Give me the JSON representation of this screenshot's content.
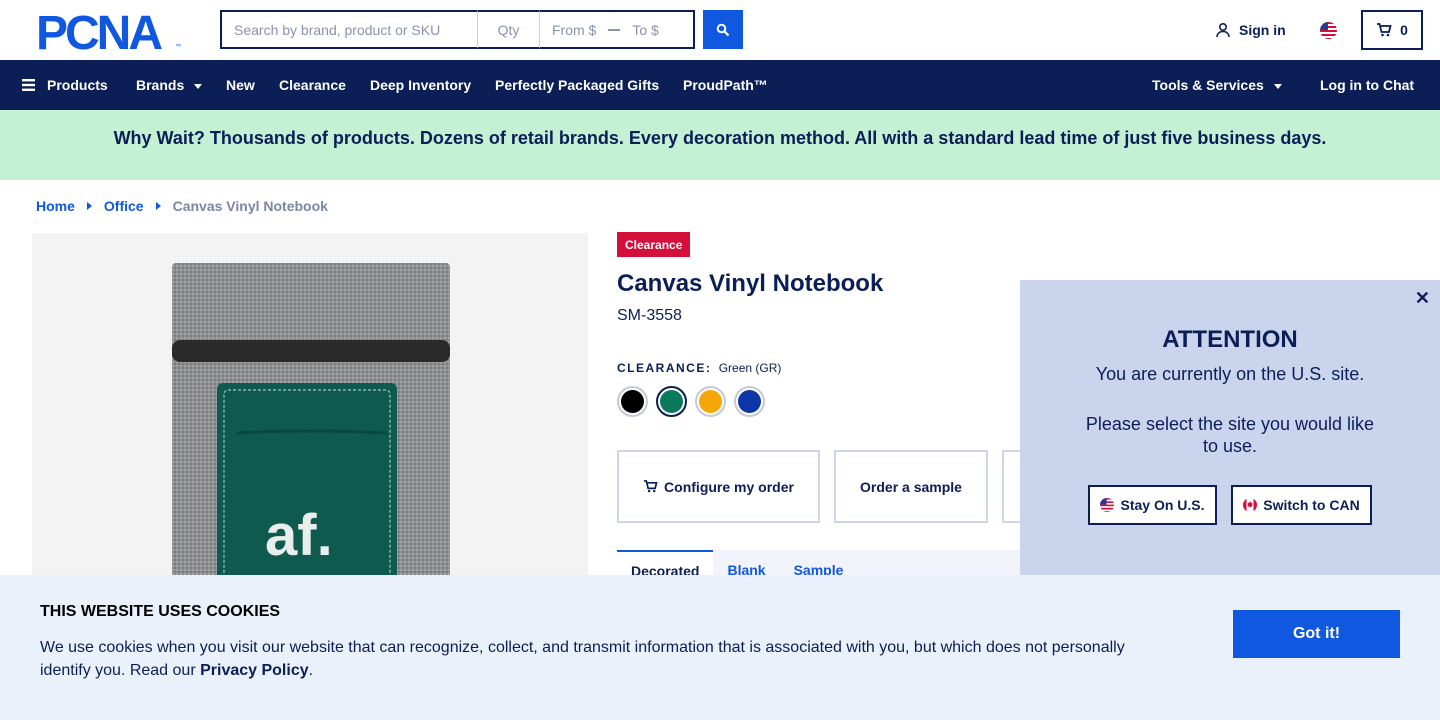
{
  "header": {
    "logo_text": "PCNA",
    "search_placeholder": "Search by brand, product or SKU",
    "qty_placeholder": "Qty",
    "from_placeholder": "From $",
    "to_placeholder": "To $",
    "sign_in_label": "Sign in",
    "cart_count": "0"
  },
  "nav": {
    "products": "Products",
    "brands": "Brands",
    "new": "New",
    "clearance": "Clearance",
    "deep_inventory": "Deep Inventory",
    "gifts": "Perfectly Packaged Gifts",
    "proudpath": "ProudPath™",
    "tools": "Tools & Services",
    "chat": "Log in to Chat"
  },
  "promo": "Why Wait? Thousands of products. Dozens of retail brands. Every decoration method. All with a standard lead time of just five business days.",
  "breadcrumb": [
    "Home",
    "Office",
    "Canvas Vinyl Notebook"
  ],
  "product": {
    "badge": "Clearance",
    "title": "Canvas Vinyl Notebook",
    "sku": "SM-3558",
    "color_label": "CLEARANCE:",
    "color_value": "Green (GR)",
    "swatches": [
      {
        "name": "Black",
        "color": "#000000"
      },
      {
        "name": "Green",
        "color": "#0b7a5a"
      },
      {
        "name": "Orange",
        "color": "#f5a70a"
      },
      {
        "name": "Royal Blue",
        "color": "#0c36a8"
      }
    ],
    "logo_on_notebook": "af.",
    "actions": {
      "configure": "Configure my order",
      "sample": "Order a sample"
    },
    "tabs": [
      "Decorated",
      "Blank",
      "Sample"
    ]
  },
  "modal": {
    "title": "ATTENTION",
    "line1": "You are currently on the U.S. site.",
    "line2": "Please select the site you would like to use.",
    "stay": "Stay On U.S.",
    "switch": "Switch to CAN"
  },
  "cookie": {
    "title": "THIS WEBSITE USES COOKIES",
    "text": "We use cookies when you visit our website that can recognize, collect, and transmit information that is associated with you, but which does not personally identify you. Read our ",
    "link": "Privacy Policy",
    "end": ".",
    "button": "Got it!"
  },
  "colors": {
    "navy": "#0b1e56",
    "blue": "#1058e0",
    "promo_bg": "#c4f0d4",
    "clearance_red": "#d50f3c"
  }
}
